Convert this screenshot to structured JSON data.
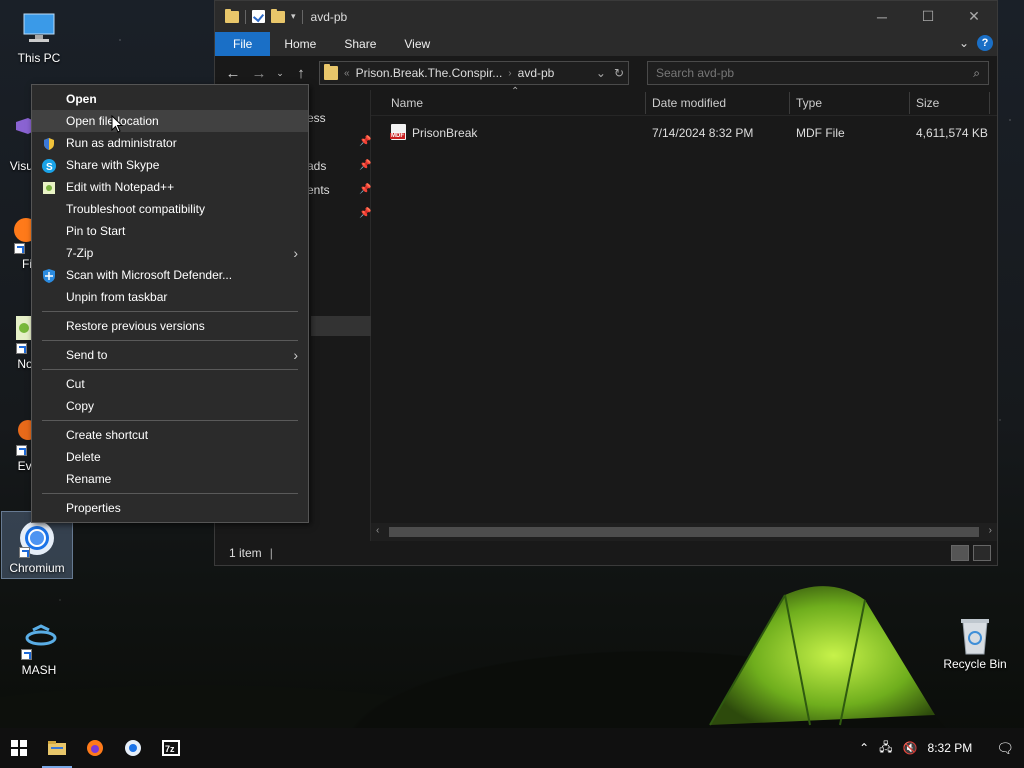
{
  "desktop": {
    "icons": [
      {
        "label": "This PC"
      },
      {
        "label": "Visual"
      },
      {
        "label": "Fi"
      },
      {
        "label": "Note"
      },
      {
        "label": "Ever"
      },
      {
        "label": "Chromium"
      },
      {
        "label": "MASH"
      },
      {
        "label": "Recycle Bin"
      }
    ]
  },
  "explorer": {
    "title": "avd-pb",
    "ribbon_tabs": [
      "File",
      "Home",
      "Share",
      "View"
    ],
    "address": {
      "crumb1": "Prison.Break.The.Conspir...",
      "crumb2": "avd-pb"
    },
    "search_placeholder": "Search avd-pb",
    "nav_items": [
      "ess",
      "ads",
      "ents"
    ],
    "columns": {
      "name": "Name",
      "date": "Date modified",
      "type": "Type",
      "size": "Size"
    },
    "files": [
      {
        "name": "PrisonBreak",
        "date": "7/14/2024 8:32 PM",
        "type": "MDF File",
        "size": "4,611,574 KB"
      }
    ],
    "status": "1 item"
  },
  "context_menu": {
    "items": [
      {
        "label": "Open"
      },
      {
        "label": "Open file location"
      },
      {
        "label": "Run as administrator"
      },
      {
        "label": "Share with Skype"
      },
      {
        "label": "Edit with Notepad++"
      },
      {
        "label": "Troubleshoot compatibility"
      },
      {
        "label": "Pin to Start"
      },
      {
        "label": "7-Zip"
      },
      {
        "label": "Scan with Microsoft Defender..."
      },
      {
        "label": "Unpin from taskbar"
      },
      {
        "label": "Restore previous versions"
      },
      {
        "label": "Send to"
      },
      {
        "label": "Cut"
      },
      {
        "label": "Copy"
      },
      {
        "label": "Create shortcut"
      },
      {
        "label": "Delete"
      },
      {
        "label": "Rename"
      },
      {
        "label": "Properties"
      }
    ]
  },
  "taskbar": {
    "time": "8:32 PM",
    "apps": [
      "start",
      "file-explorer",
      "firefox",
      "chromium",
      "7-zip"
    ]
  },
  "colors": {
    "accent": "#1a6fc6",
    "menu_bg": "#2b2b2b",
    "window_bg": "#191919"
  }
}
